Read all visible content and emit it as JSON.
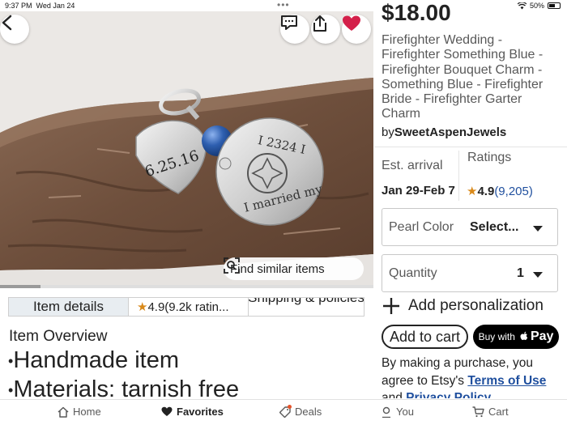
{
  "status": {
    "time": "9:37 PM",
    "date": "Wed Jan 24",
    "battery_pct": "50%",
    "battery_level": 0.5,
    "icons": [
      "wifi-icon",
      "battery-icon"
    ]
  },
  "photo": {
    "buttons": [
      "back-icon",
      "comment-icon",
      "share-icon",
      "heart-icon"
    ],
    "find_similar": "Find similar items",
    "charm_date": "6.25.16",
    "charm_ring_text_top": "I 2324 I",
    "charm_ring_text_bottom": "I married my",
    "colors": {
      "heart": "#d4204a",
      "pearl": "#2e5fb0",
      "wood": "#7a5a45"
    }
  },
  "tabs": {
    "item_details": "Item details",
    "rating": "4.9(9.2k ratin...",
    "shipping": "Shipping & policies"
  },
  "overview": {
    "title": "Item Overview",
    "items": [
      "Handmade item",
      "Materials: tarnish free"
    ]
  },
  "listing": {
    "price": "$18.00",
    "title": "Firefighter Wedding - Firefighter Something Blue - Firefighter Bouquet Charm - Something Blue - Firefighter Bride - Firefighter Garter Charm",
    "by": "by",
    "seller": "SweetAspenJewels",
    "est_label": "Est. arrival",
    "est_value": "Jan 29-Feb 7",
    "ratings_label": "Ratings",
    "rating_value": "4.9",
    "rating_count": "(9,205)",
    "pearl_label": "Pearl Color",
    "pearl_value": "Select...",
    "qty_label": "Quantity",
    "qty_value": "1",
    "add_personalization": "Add personalization",
    "add_to_cart": "Add to cart",
    "buy_with": "Buy with",
    "pay": "Pay",
    "legal_prefix": "By making a purchase, you agree to Etsy's ",
    "terms": "Terms of Use",
    "legal_and": " and ",
    "privacy": "Privacy Policy"
  },
  "nav": {
    "home": "Home",
    "favorites": "Favorites",
    "deals": "Deals",
    "you": "You",
    "cart": "Cart"
  }
}
